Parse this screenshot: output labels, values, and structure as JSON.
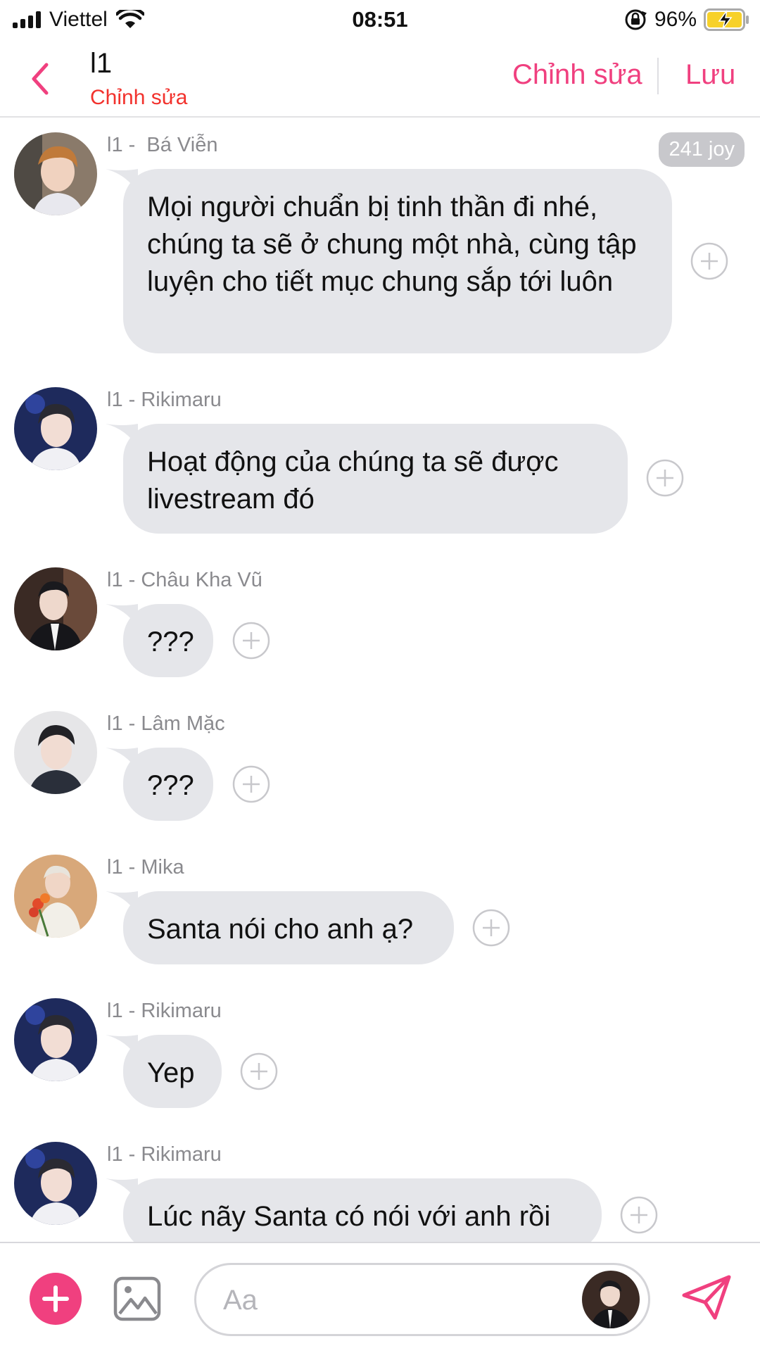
{
  "status_bar": {
    "carrier": "Viettel",
    "time": "08:51",
    "battery_percent": "96%",
    "icons": [
      "signal-icon",
      "wifi-icon",
      "rotation-lock-icon",
      "battery-charging-icon"
    ]
  },
  "header": {
    "title": "l1",
    "subtitle": "Chỉnh sửa",
    "edit_label": "Chỉnh sửa",
    "save_label": "Lưu",
    "accent_color": "#f0407f",
    "subtitle_color": "#f2322d"
  },
  "messages": [
    {
      "sender": "l1 -  Bá Viễn",
      "text": "Mọi người chuẩn bị tinh thần đi nhé, chúng ta sẽ ở chung một nhà, cùng tập luyện cho tiết mục chung sắp tới luôn",
      "badge": "241 joy"
    },
    {
      "sender": "l1 - Rikimaru",
      "text": "Hoạt động của chúng ta sẽ được livestream đó"
    },
    {
      "sender": "l1 - Châu Kha Vũ",
      "text": "???"
    },
    {
      "sender": "l1 - Lâm Mặc",
      "text": "???"
    },
    {
      "sender": "l1 - Mika",
      "text": "Santa nói cho anh ạ?"
    },
    {
      "sender": "l1 - Rikimaru",
      "text": "Yep"
    },
    {
      "sender": "l1 - Rikimaru",
      "text": "Lúc nãy Santa có nói với anh rồi"
    }
  ],
  "composer": {
    "placeholder": "Aa",
    "icons": [
      "add-icon",
      "image-icon",
      "send-icon"
    ]
  },
  "colors": {
    "bubble": "#e5e6ea",
    "sender_text": "#8a8a8e",
    "badge": "#c8c8cc"
  }
}
